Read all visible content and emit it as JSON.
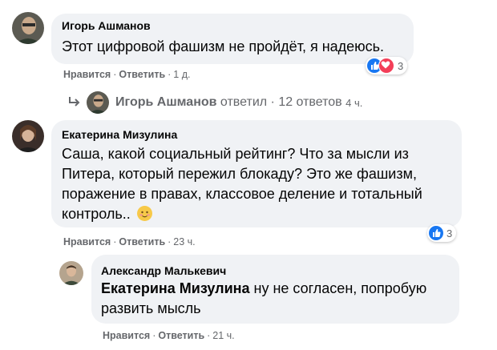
{
  "comments": [
    {
      "author": "Игорь Ашманов",
      "text": "Этот цифровой фашизм не пройдёт, я надеюсь.",
      "like_label": "Нравится",
      "reply_label": "Ответить",
      "time": "1 д.",
      "reactions": {
        "icons": [
          "like-icon",
          "love-icon"
        ],
        "count": "3"
      }
    },
    {
      "author": "Екатерина Мизулина",
      "text_lines": [
        "Саша, какой социальный рейтинг? Что за мысли из",
        "Питера, который пережил блокаду? Это же фашизм,",
        "поражение в правах, классовое деление и тотальный",
        "контроль.."
      ],
      "emoji": "smiling-face-icon",
      "like_label": "Нравится",
      "reply_label": "Ответить",
      "time": "23 ч.",
      "reactions": {
        "icons": [
          "like-icon"
        ],
        "count": "3"
      }
    },
    {
      "author": "Александр Малькевич",
      "mention": "Екатерина Мизулина",
      "text_lines": [
        " ну не согласен, попробую",
        "развить мысль"
      ],
      "like_label": "Нравится",
      "reply_label": "Ответить",
      "time": "21 ч."
    }
  ],
  "reply_thread": {
    "author": "Игорь Ашманов",
    "replied_label": "ответил",
    "count_label": "12 ответов",
    "time": "4 ч."
  },
  "colors": {
    "bubble": "#f0f2f5",
    "meta_text": "#65676b",
    "like_blue": "#1877f2",
    "love_red": "#f33e58"
  }
}
